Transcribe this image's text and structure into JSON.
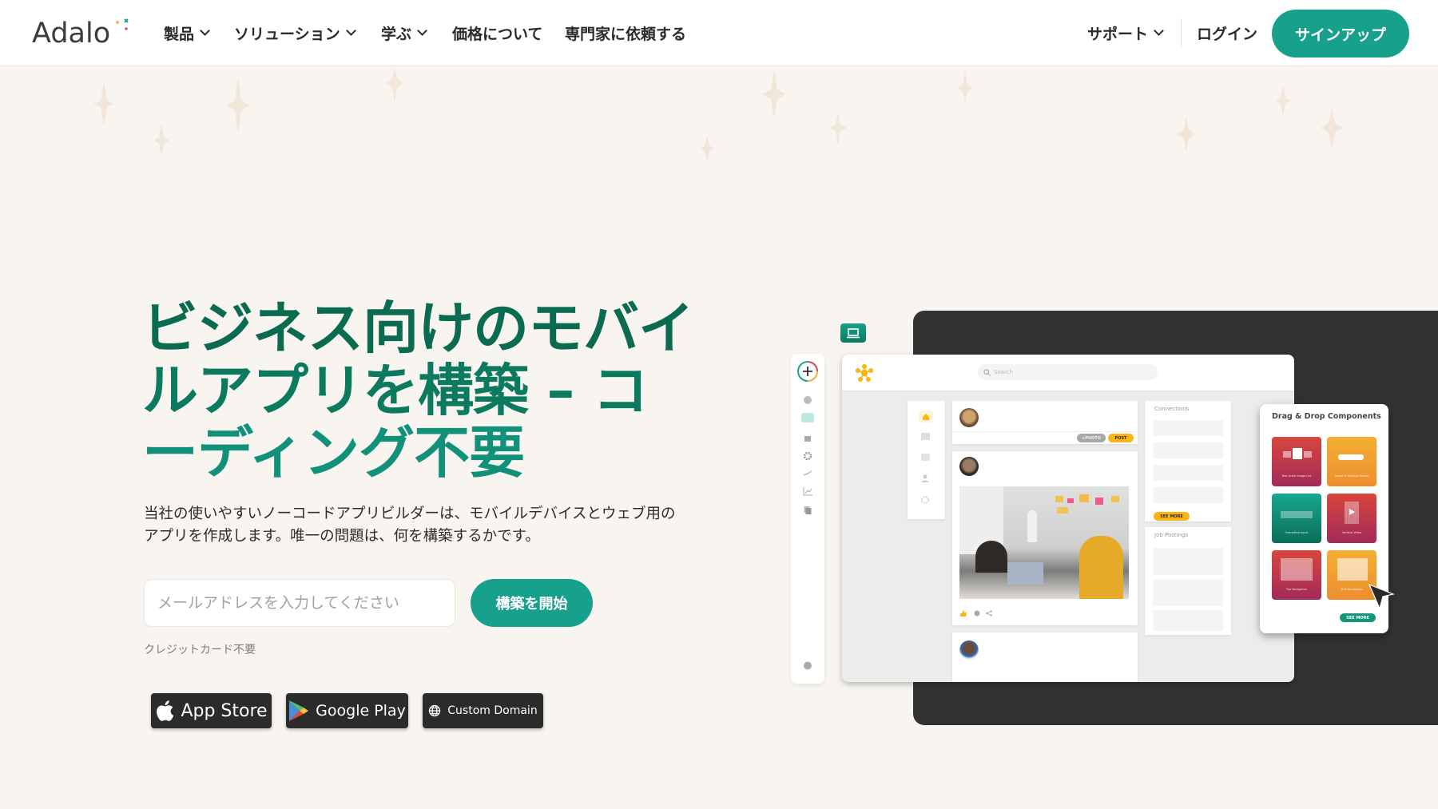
{
  "nav": {
    "logo": "Adalo",
    "items": [
      {
        "label": "製品",
        "dropdown": true
      },
      {
        "label": "ソリューション",
        "dropdown": true
      },
      {
        "label": "学ぶ",
        "dropdown": true
      },
      {
        "label": "価格について",
        "dropdown": false
      },
      {
        "label": "専門家に依頼する",
        "dropdown": false
      }
    ],
    "support": "サポート",
    "login": "ログイン",
    "signup": "サインアップ"
  },
  "hero": {
    "headline_lines": [
      "ビジネス向けのモバイ",
      "ルアプリを構築 – コ",
      "ーディング不要"
    ],
    "subtext": "当社の使いやすいノーコードアプリビルダーは、モバイルデバイスとウェブ用のアプリを作成します。唯一の問題は、何を構築するかです。",
    "email_placeholder": "メールアドレスを入力してください",
    "email_value": "",
    "cta": "構築を開始",
    "note": "クレジットカード不要",
    "badges": [
      {
        "label": "App Store",
        "icon": "apple-icon"
      },
      {
        "label": "Google Play",
        "icon": "google-play-icon"
      },
      {
        "label": "Custom Domain",
        "icon": "globe-icon"
      }
    ]
  },
  "mockup": {
    "search_placeholder": "Search",
    "photo_pill": "+PHOTO",
    "post_pill": "POST",
    "connections_title": "Connections",
    "see_more": "SEE MORE",
    "job_postings_title": "Job Postings",
    "dd_title": "Drag & Drop Components",
    "tiles": [
      {
        "label": "Tear-Scale Image List"
      },
      {
        "label": "Image & Shadow Button"
      },
      {
        "label": "Formatted Input"
      },
      {
        "label": "Vertical Video"
      },
      {
        "label": "Top Navigation"
      },
      {
        "label": "Side Navigation"
      }
    ],
    "dd_see_more": "SEE MORE"
  },
  "colors": {
    "brand_green": "#17a08c",
    "headline_green": "#0e7d63",
    "background": "#f8f5f1",
    "accent_yellow": "#fbb516"
  }
}
